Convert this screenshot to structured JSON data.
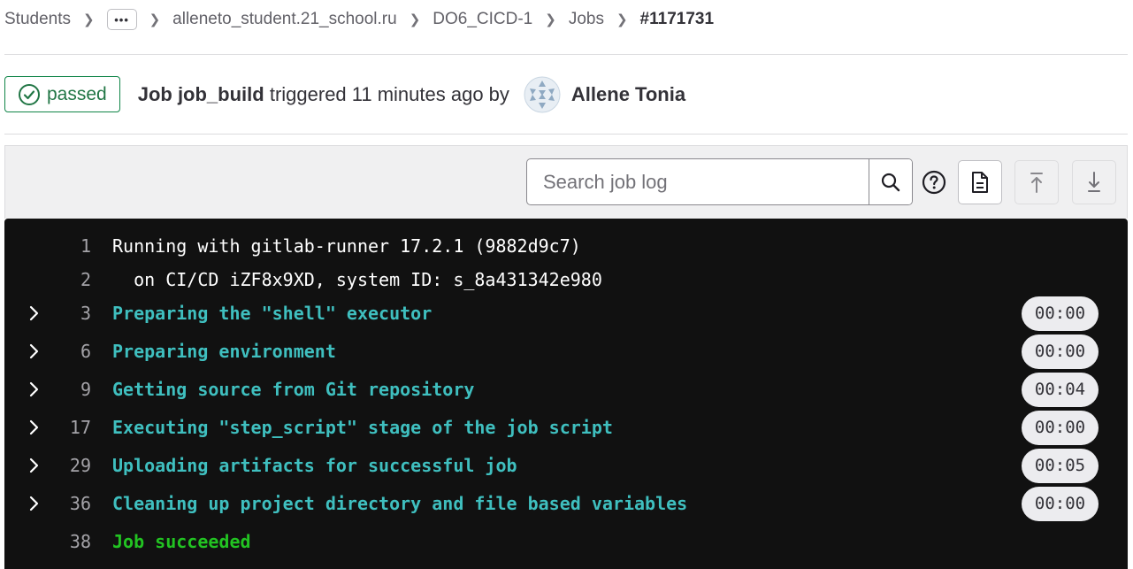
{
  "breadcrumb": {
    "items": [
      "Students",
      "alleneto_student.21_school.ru",
      "DO6_CICD-1",
      "Jobs"
    ],
    "ellipsis": "•••",
    "current": "#1171731"
  },
  "job": {
    "status": "passed",
    "title_prefix": "Job job_build",
    "triggered_text": " triggered 11 minutes ago by",
    "author": "Allene Tonia"
  },
  "toolbar": {
    "search_placeholder": "Search job log",
    "icons": [
      "search-icon",
      "question-icon",
      "raw-log-icon",
      "scroll-to-top-icon",
      "scroll-to-bottom-icon"
    ]
  },
  "log": {
    "lines": [
      {
        "n": "1",
        "text": "Running with gitlab-runner 17.2.1 (9882d9c7)",
        "kind": "plain"
      },
      {
        "n": "2",
        "text": "  on CI/CD iZF8x9XD, system ID: s_8a431342e980",
        "kind": "plain"
      },
      {
        "n": "3",
        "text": "Preparing the \"shell\" executor",
        "kind": "section",
        "duration": "00:00"
      },
      {
        "n": "6",
        "text": "Preparing environment",
        "kind": "section",
        "duration": "00:00"
      },
      {
        "n": "9",
        "text": "Getting source from Git repository",
        "kind": "section",
        "duration": "00:04"
      },
      {
        "n": "17",
        "text": "Executing \"step_script\" stage of the job script",
        "kind": "section",
        "duration": "00:00"
      },
      {
        "n": "29",
        "text": "Uploading artifacts for successful job",
        "kind": "section",
        "duration": "00:05"
      },
      {
        "n": "36",
        "text": "Cleaning up project directory and file based variables",
        "kind": "section",
        "duration": "00:00"
      },
      {
        "n": "38",
        "text": "Job succeeded",
        "kind": "success"
      }
    ]
  },
  "colors": {
    "success": "#108548",
    "log_bg": "#111111",
    "section_text": "#3fbfbf",
    "success_text": "#22c322"
  }
}
